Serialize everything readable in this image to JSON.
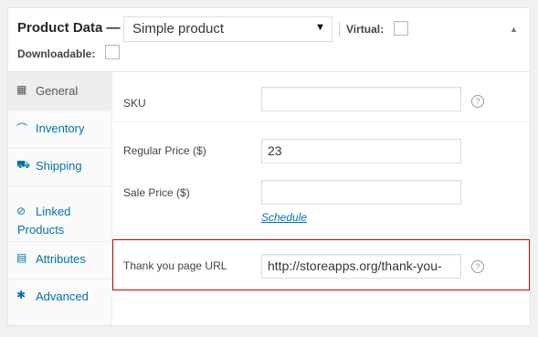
{
  "header": {
    "title": "Product Data —",
    "product_type": "Simple product",
    "select_arrow": "▼",
    "virtual_label": "Virtual:",
    "downloadable_label": "Downloadable:",
    "collapse_arrow": "▲"
  },
  "tabs": [
    {
      "label": "General",
      "icon": "grid-icon",
      "glyph": "▦",
      "active": true
    },
    {
      "label": "Inventory",
      "icon": "inventory-icon",
      "glyph": "⌒",
      "active": false
    },
    {
      "label": "Shipping",
      "icon": "truck-icon",
      "glyph": "⛟",
      "active": false
    },
    {
      "label": "Linked",
      "label2": "Products",
      "icon": "link-icon",
      "glyph": "⊘",
      "active": false
    },
    {
      "label": "Attributes",
      "icon": "list-icon",
      "glyph": "▤",
      "active": false
    },
    {
      "label": "Advanced",
      "icon": "gear-icon",
      "glyph": "✱",
      "active": false
    }
  ],
  "fields": {
    "sku": {
      "label": "SKU",
      "value": ""
    },
    "regular_price": {
      "label": "Regular Price ($)",
      "value": "23"
    },
    "sale_price": {
      "label": "Sale Price ($)",
      "value": "",
      "schedule_link": "Schedule"
    },
    "thank_you_url": {
      "label": "Thank you page URL",
      "value": "http://storeapps.org/thank-you-"
    }
  },
  "help_glyph": "?",
  "colors": {
    "link": "#0073aa",
    "highlight": "#cc0000",
    "active_tab_bg": "#eeeeee"
  }
}
